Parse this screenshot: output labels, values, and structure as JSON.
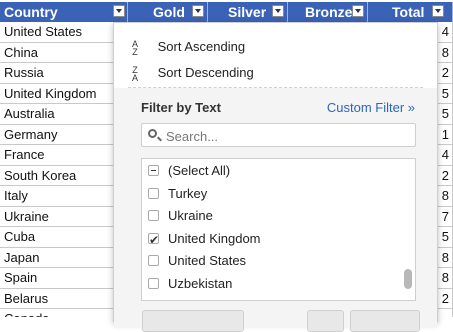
{
  "columns": [
    {
      "label": "Country"
    },
    {
      "label": "Gold"
    },
    {
      "label": "Silver"
    },
    {
      "label": "Bronze"
    },
    {
      "label": "Total"
    }
  ],
  "rows": [
    {
      "country": "United States",
      "total_partial": "4"
    },
    {
      "country": "China",
      "total_partial": "8"
    },
    {
      "country": "Russia",
      "total_partial": "2"
    },
    {
      "country": "United Kingdom",
      "total_partial": "5"
    },
    {
      "country": "Australia",
      "total_partial": "5"
    },
    {
      "country": "Germany",
      "total_partial": "1"
    },
    {
      "country": "France",
      "total_partial": "4"
    },
    {
      "country": "South Korea",
      "total_partial": "2"
    },
    {
      "country": "Italy",
      "total_partial": "8"
    },
    {
      "country": "Ukraine",
      "total_partial": "7"
    },
    {
      "country": "Cuba",
      "total_partial": "5"
    },
    {
      "country": "Japan",
      "total_partial": "8"
    },
    {
      "country": "Spain",
      "total_partial": "8"
    },
    {
      "country": "Belarus",
      "total_partial": "2"
    },
    {
      "country": "Canada",
      "total_partial": ""
    }
  ],
  "popup": {
    "sort_ascending": "Sort Ascending",
    "sort_descending": "Sort Descending",
    "filter_title": "Filter by Text",
    "custom_filter": "Custom Filter »",
    "search_placeholder": "Search...",
    "items": [
      {
        "label": "(Select All)",
        "state": "partial"
      },
      {
        "label": "Turkey",
        "state": "unchecked"
      },
      {
        "label": "Ukraine",
        "state": "unchecked"
      },
      {
        "label": "United Kingdom",
        "state": "checked"
      },
      {
        "label": "United States",
        "state": "unchecked"
      },
      {
        "label": "Uzbekistan",
        "state": "unchecked"
      }
    ]
  },
  "colors": {
    "header_bg": "#3a63b8",
    "link": "#2a68b6"
  }
}
